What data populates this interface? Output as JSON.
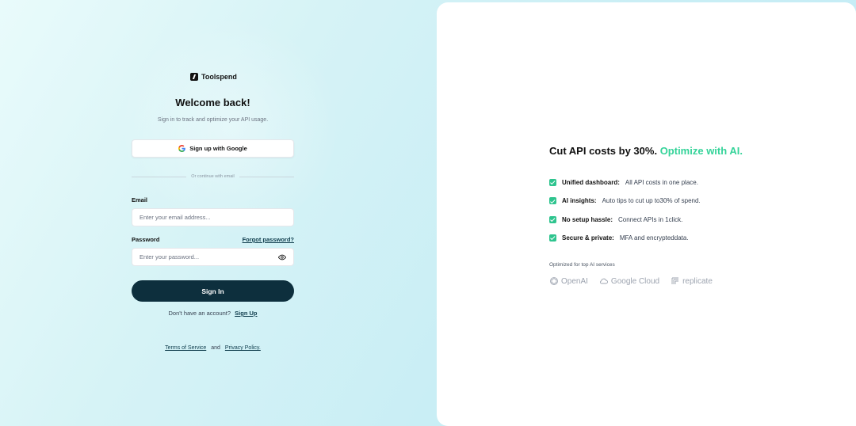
{
  "brand": {
    "name": "Toolspend"
  },
  "login": {
    "title": "Welcome back!",
    "subtitle": "Sign in to track and optimize your API usage.",
    "google_button": "Sign up with Google",
    "divider": "Or continue with email",
    "email_label": "Email",
    "email_placeholder": "Enter your email address...",
    "password_label": "Password",
    "forgot_link": "Forgot password?",
    "password_placeholder": "Enter your password...",
    "signin_button": "Sign In",
    "no_account_text": "Don't have an account?",
    "signup_link": "Sign Up",
    "terms_link": "Terms of Service",
    "and_text": "and",
    "privacy_link": "Privacy Policy."
  },
  "promo": {
    "headline": "Cut API costs by 30%.",
    "headline_accent": "Optimize with AI.",
    "features": [
      {
        "bold": "Unified dashboard:",
        "text": "All API costs in one place."
      },
      {
        "bold": "AI insights:",
        "text": "Auto tips to cut up to30% of spend."
      },
      {
        "bold": "No setup hassle:",
        "text": "Connect APIs in 1click."
      },
      {
        "bold": "Secure & private:",
        "text": "MFA and encrypteddata."
      }
    ],
    "optimized_label": "Optimized for top AI services",
    "logos": [
      "OpenAI",
      "Google Cloud",
      "replicate"
    ]
  },
  "colors": {
    "accent": "#34d399",
    "button_dark": "#0d2f3d",
    "check": "#2ec48e"
  },
  "icons": {
    "google": "google-icon",
    "eye": "eye-icon",
    "check": "check-icon"
  }
}
